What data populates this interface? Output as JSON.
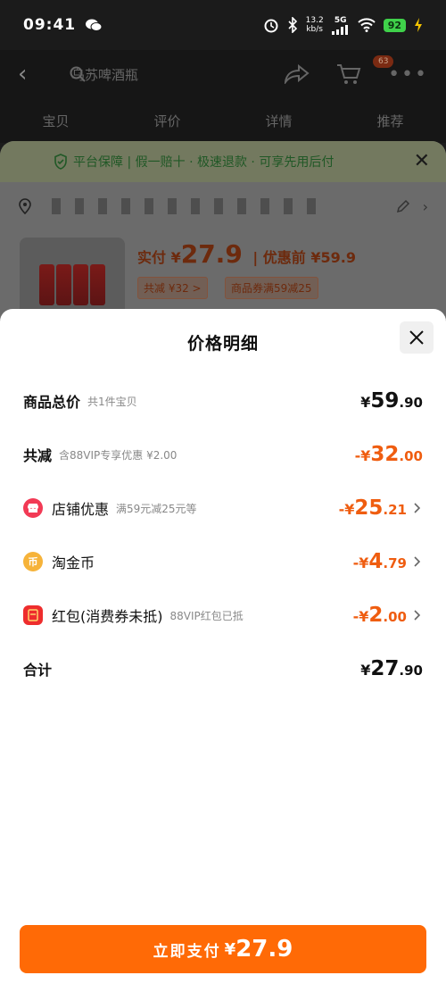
{
  "status_bar": {
    "time": "09:41",
    "speed_top": "13.2",
    "speed_bottom": "kb/s",
    "network": "5G",
    "battery": "92"
  },
  "nav": {
    "search_text": "乌苏啤酒瓶",
    "cart_count": "63"
  },
  "tabs": [
    "宝贝",
    "评价",
    "详情",
    "推荐"
  ],
  "guarantee": {
    "text": "平台保障 | 假一赔十 · 极速退款 · 可享先用后付"
  },
  "product_preview": {
    "price_label": "实付 ¥",
    "price": "27.9",
    "pre_discount": "| 优惠前 ¥59.9",
    "chip_total": "共减 ¥32 >",
    "chip_coupon": "商品券满59减25"
  },
  "sheet": {
    "title": "价格明细",
    "rows": [
      {
        "label": "商品总价",
        "sub": "共1件宝贝",
        "cur": "¥",
        "int": "59",
        "dec": ".90"
      },
      {
        "label": "共减",
        "sub": "含88VIP专享优惠 ¥2.00",
        "cur": "-¥",
        "int": "32",
        "dec": ".00"
      },
      {
        "label": "店铺优惠",
        "sub": "满59元减25元等",
        "cur": "-¥",
        "int": "25",
        "dec": ".21"
      },
      {
        "label": "淘金币",
        "sub": "",
        "cur": "-¥",
        "int": "4",
        "dec": ".79"
      },
      {
        "label": "红包(消费券未抵)",
        "sub": "88VIP红包已抵",
        "cur": "-¥",
        "int": "2",
        "dec": ".00"
      },
      {
        "label": "合计",
        "sub": "",
        "cur": "¥",
        "int": "27",
        "dec": ".90"
      }
    ],
    "icon_shop_text": "🏪",
    "icon_coin_text": "币"
  },
  "pay_button": {
    "label": "立即支付",
    "cur": "¥",
    "amount": "27.9"
  },
  "colors": {
    "accent": "#ff6a06",
    "discount": "#ef5d10"
  }
}
